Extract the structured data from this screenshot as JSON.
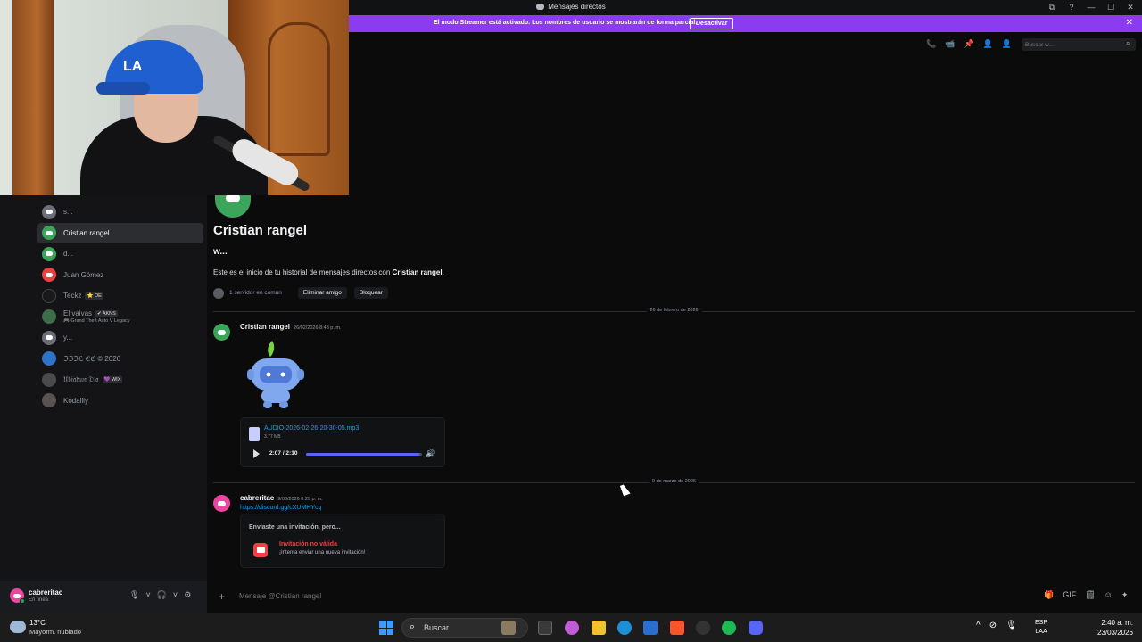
{
  "window": {
    "title": "Mensajes directos",
    "controls": [
      "⧉",
      "?",
      "—",
      "☐",
      "✕"
    ]
  },
  "streamer_banner": {
    "text": "El modo Streamer está activado. Los nombres de usuario se mostrarán de forma parcial.",
    "button": "Desactivar",
    "close": "✕"
  },
  "sidebar": {
    "dms": [
      {
        "name": "s...",
        "color": "#6d6f78"
      },
      {
        "name": "Cristian rangel",
        "color": "#3ba55c",
        "active": true
      },
      {
        "name": "d...",
        "color": "#3ba55c"
      },
      {
        "name": "Juan Gómez",
        "color": "#ed4245"
      },
      {
        "name": "Teckz",
        "tag": "⭐ OE",
        "color": "#1a1a1a"
      },
      {
        "name": "El vaivas",
        "tag": "✔ AKNS",
        "sub": "🎮 Grand Theft Auto V Legacy",
        "color": "#3c6e4a"
      },
      {
        "name": "y...",
        "color": "#6d6f78"
      },
      {
        "name": "ℑℑℑℒ ℭℭ © 2026",
        "color": "#2f73c9"
      },
      {
        "name": "𝔘𝔟𝔦𝔞𝔡𝔲𝔫 𝔇𝔩𝔞",
        "tag": "💜 WIX",
        "color": "#4a4a4a"
      },
      {
        "name": "Kodallly",
        "color": "#5a5250"
      }
    ]
  },
  "user_panel": {
    "name": "cabreritac",
    "status": "En línea",
    "icons": [
      "🎙",
      "˅",
      "🎧",
      "˅",
      "⚙"
    ]
  },
  "toolbar": {
    "icons": [
      "📞",
      "📹",
      "📌",
      "👤",
      "👤"
    ],
    "search_placeholder": "Buscar w...",
    "search_icon": "⌕"
  },
  "intro": {
    "name": "Cristian rangel",
    "handle": "w...",
    "text_prefix": "Este es el inicio de tu historial de mensajes directos con ",
    "text_bold": "Cristian rangel",
    "text_suffix": ".",
    "mutual": "1 servidor en común",
    "remove_friend": "Eliminar amigo",
    "block": "Bloquear"
  },
  "messages": {
    "date1": "26 de febrero de 2026",
    "msg1": {
      "author": "Cristian rangel",
      "time": "26/02/2026 8:43 p. m.",
      "file_name": "AUDIO-2026-02-26-20-30-05.mp3",
      "file_size": "3.77 MB",
      "player_time": "2:07 / 2:10",
      "progress": 0.977
    },
    "date2": "9 de marzo de 2026",
    "msg2": {
      "author": "cabreritac",
      "time": "9/03/2026 8:29 p. m.",
      "link": "https://discord.gg/cXUMHYcq",
      "invite_heading": "Enviaste una invitación, pero...",
      "invite_title": "Invitación no válida",
      "invite_sub": "¡Intenta enviar una nueva invitación!"
    }
  },
  "composer": {
    "plus": "+",
    "placeholder": "Mensaje @Cristian rangel",
    "icons": [
      "🎁",
      "GIF",
      "🗒",
      "☺",
      "✦"
    ]
  },
  "taskbar": {
    "temp": "13°C",
    "weather": "Mayorm. nublado",
    "search": "Buscar",
    "search_icon": "⌕",
    "tray_icons": [
      "^",
      "⊘",
      "🎙"
    ],
    "lang1": "ESP",
    "lang2": "LAA",
    "time": "2:40 a. m.",
    "date": "23/03/2026"
  }
}
